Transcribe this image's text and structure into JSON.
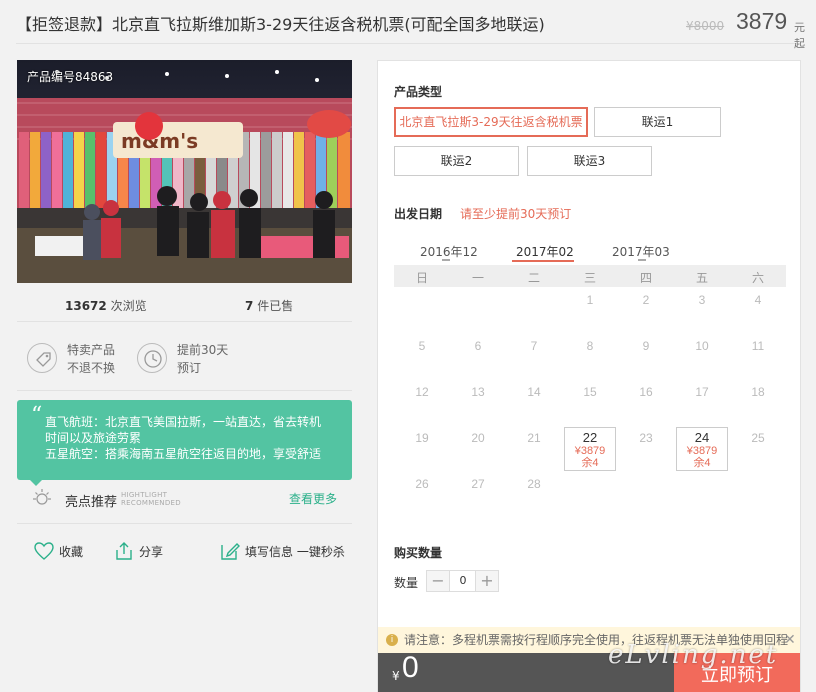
{
  "header": {
    "title": "【拒签退款】北京直飞拉斯维加斯3-29天往返含税机票(可配全国多地联运)",
    "original_price": "¥8000",
    "price": "3879",
    "price_unit": "元起"
  },
  "photo": {
    "code": "产品编号84863"
  },
  "stats": {
    "views_num": "13672",
    "views_label": "次浏览",
    "sold_num": "7",
    "sold_label": "件已售"
  },
  "tags": [
    {
      "line1": "特卖产品",
      "line2": "不退不换",
      "icon": "tag-icon"
    },
    {
      "line1": "提前30天",
      "line2": "预订",
      "icon": "clock-icon"
    }
  ],
  "features": {
    "line1": "直飞航班：北京直飞美国拉斯，一站直达，省去转机",
    "line2": "时间以及旅途劳累",
    "line3": "五星航空：搭乘海南五星航空往返目的地，享受舒适"
  },
  "highlight": {
    "title": "亮点推荐",
    "en1": "HIGHTLIGHT",
    "en2": "RECOMMENDED",
    "more": "查看更多"
  },
  "actions": {
    "fav": "收藏",
    "share": "分享",
    "fill": "填写信息 一键秒杀"
  },
  "product_type": {
    "label": "产品类型",
    "options": [
      "北京直飞拉斯3-29天往返含税机票",
      "联运1",
      "联运2",
      "联运3"
    ]
  },
  "departure": {
    "label": "出发日期",
    "hint": "请至少提前30天预订",
    "months": [
      "2016年12",
      "2017年02",
      "2017年03"
    ],
    "weekdays": [
      "日",
      "一",
      "二",
      "三",
      "四",
      "五",
      "六"
    ],
    "weeks": [
      [
        "",
        "",
        "",
        "1",
        "2",
        "3",
        "4"
      ],
      [
        "5",
        "6",
        "7",
        "8",
        "9",
        "10",
        "11"
      ],
      [
        "12",
        "13",
        "14",
        "15",
        "16",
        "17",
        "18"
      ],
      [
        "19",
        "20",
        "21",
        "22",
        "23",
        "24",
        "25"
      ],
      [
        "26",
        "27",
        "28",
        "",
        "",
        "",
        ""
      ]
    ],
    "available": {
      "22": {
        "price": "¥3879",
        "remain": "余4"
      },
      "24": {
        "price": "¥3879",
        "remain": "余4"
      }
    }
  },
  "quantity": {
    "section": "购买数量",
    "label": "数量",
    "minus": "−",
    "plus": "+",
    "value": "0"
  },
  "notice": {
    "icon": "i",
    "text": "请注意：多程机票需按行程顺序完全使用，往返程机票无法单独使用回程",
    "close": "✕"
  },
  "bottom": {
    "currency": "¥",
    "total": "0",
    "buy": "立即预订"
  },
  "watermark": "eLvling.net",
  "colors": {
    "accent": "#e56b57",
    "green": "#53c4a2",
    "buy": "#f26a5b"
  }
}
